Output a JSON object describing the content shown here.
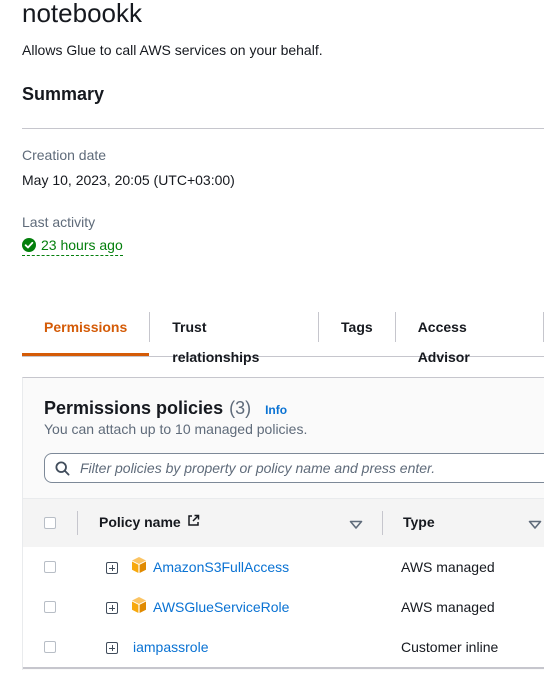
{
  "role": {
    "name": "notebookk",
    "description": "Allows Glue to call AWS services on your behalf."
  },
  "summary": {
    "heading": "Summary",
    "creation_date_label": "Creation date",
    "creation_date_value": "May 10, 2023, 20:05 (UTC+03:00)",
    "last_activity_label": "Last activity",
    "last_activity_value": "23 hours ago"
  },
  "tabs": [
    {
      "label": "Permissions",
      "active": true
    },
    {
      "label": "Trust relationships",
      "active": false
    },
    {
      "label": "Tags",
      "active": false
    },
    {
      "label": "Access Advisor",
      "active": false
    }
  ],
  "permissions": {
    "title": "Permissions policies",
    "count": "(3)",
    "info_link": "Info",
    "subtitle": "You can attach up to 10 managed policies.",
    "filter_placeholder": "Filter policies by property or policy name and press enter.",
    "columns": {
      "policy_name": "Policy name",
      "type": "Type"
    },
    "rows": [
      {
        "name": "AmazonS3FullAccess",
        "type": "AWS managed",
        "icon": "aws-managed-cube-icon"
      },
      {
        "name": "AWSGlueServiceRole",
        "type": "AWS managed",
        "icon": "aws-managed-cube-icon"
      },
      {
        "name": "iampassrole",
        "type": "Customer inline",
        "icon": ""
      }
    ]
  },
  "colors": {
    "accent_tab": "#d45b07",
    "link": "#0972d3",
    "success": "#037f0c",
    "aws_cube": "#f7a80d"
  }
}
